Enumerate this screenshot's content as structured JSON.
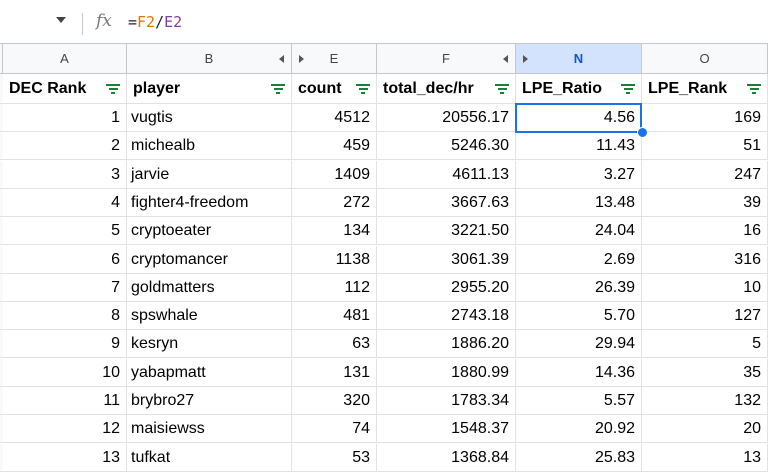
{
  "formula_bar": {
    "namebox_dropdown": "chevron-down-icon",
    "fx_label": "fx",
    "formula": {
      "eq": "=",
      "ref1": "F2",
      "op": "/",
      "ref2": "E2"
    },
    "ref1_color": "#e37400",
    "ref2_color": "#7b3fa0"
  },
  "columns": [
    {
      "letter": "A",
      "header": "DEC Rank",
      "align": "num"
    },
    {
      "letter": "B",
      "header": "player",
      "align": "txt"
    },
    {
      "letter": "E",
      "header": "count",
      "align": "num"
    },
    {
      "letter": "F",
      "header": "total_dec/hr",
      "align": "num"
    },
    {
      "letter": "N",
      "header": "LPE_Ratio",
      "align": "num"
    },
    {
      "letter": "O",
      "header": "LPE_Rank",
      "align": "num"
    }
  ],
  "rows": [
    [
      "1",
      "vugtis",
      "4512",
      "20556.17",
      "4.56",
      "169"
    ],
    [
      "2",
      "michealb",
      "459",
      "5246.30",
      "11.43",
      "51"
    ],
    [
      "3",
      "jarvie",
      "1409",
      "4611.13",
      "3.27",
      "247"
    ],
    [
      "4",
      "fighter4-freedom",
      "272",
      "3667.63",
      "13.48",
      "39"
    ],
    [
      "5",
      "cryptoeater",
      "134",
      "3221.50",
      "24.04",
      "16"
    ],
    [
      "6",
      "cryptomancer",
      "1138",
      "3061.39",
      "2.69",
      "316"
    ],
    [
      "7",
      "goldmatters",
      "112",
      "2955.20",
      "26.39",
      "10"
    ],
    [
      "8",
      "spswhale",
      "481",
      "2743.18",
      "5.70",
      "127"
    ],
    [
      "9",
      "kesryn",
      "63",
      "1886.20",
      "29.94",
      "5"
    ],
    [
      "10",
      "yabapmatt",
      "131",
      "1880.99",
      "14.36",
      "35"
    ],
    [
      "11",
      "brybro27",
      "320",
      "1783.34",
      "5.57",
      "132"
    ],
    [
      "12",
      "maisiewss",
      "74",
      "1548.37",
      "20.92",
      "20"
    ],
    [
      "13",
      "tufkat",
      "53",
      "1368.84",
      "25.83",
      "13"
    ]
  ],
  "colors": {
    "selection": "#1a73e8",
    "filter_icon": "#188038",
    "selected_header_bg": "#d3e3fd"
  }
}
